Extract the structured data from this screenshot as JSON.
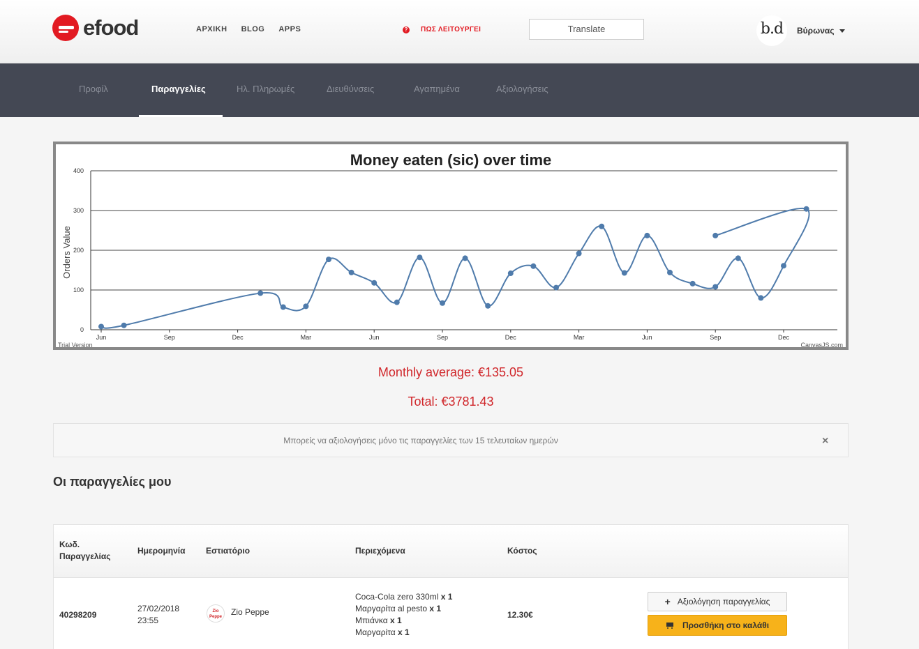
{
  "header": {
    "logo_text": "efood",
    "nav": [
      "ΑΡΧΙΚΗ",
      "BLOG",
      "APPS"
    ],
    "help_icon": "?",
    "help_text": "ΠΩΣ ΛΕΙΤΟΥΡΓΕΙ",
    "translate_label": "Translate",
    "avatar_text": "b.d",
    "user_name": "Βύρωνας"
  },
  "subnav": {
    "tabs": [
      "Προφίλ",
      "Παραγγελίες",
      "Ηλ. Πληρωμές",
      "Διευθύνσεις",
      "Αγαπημένα",
      "Αξιολογήσεις"
    ],
    "active_index": 1
  },
  "chart_data": {
    "type": "line",
    "title": "Money eaten (sic) over time",
    "ylabel": "Orders Value",
    "xlabel": "",
    "ylim": [
      0,
      400
    ],
    "yticks": [
      0,
      100,
      200,
      300,
      400
    ],
    "xticks": [
      "Jun",
      "Sep",
      "Dec",
      "Mar",
      "Jun",
      "Sep",
      "Dec",
      "Mar",
      "Jun",
      "Sep",
      "Dec"
    ],
    "x_months": [
      0,
      1,
      7,
      8,
      9,
      10,
      11,
      12,
      13,
      14,
      15,
      16,
      17,
      18,
      19,
      20,
      21,
      22,
      23,
      24,
      25,
      26,
      27,
      28,
      29,
      30,
      31
    ],
    "values": [
      8,
      11,
      92,
      57,
      59,
      177,
      144,
      118,
      69,
      182,
      67,
      180,
      60,
      142,
      160,
      106,
      192,
      260,
      143,
      237,
      144,
      116,
      108,
      180,
      80,
      161,
      304,
      237
    ],
    "grid": true,
    "line_color": "#4f7bab",
    "watermark_left": "Trial Version",
    "watermark_right": "CanvasJS.com"
  },
  "summary": {
    "monthly_average": "Monthly average: €135.05",
    "total": "Total: €3781.43"
  },
  "notice": {
    "text": "Μπορείς να αξιολογήσεις μόνο τις παραγγελίες των 15 τελευταίων ημερών",
    "close_label": "×"
  },
  "orders": {
    "title": "Οι παραγγελίες μου",
    "headers": {
      "code_line1": "Κωδ.",
      "code_line2": "Παραγγελίας",
      "date": "Ημερομηνία",
      "restaurant": "Εστιατόριο",
      "contents": "Περιεχόμενα",
      "cost": "Κόστος"
    },
    "rows": [
      {
        "code": "40298209",
        "date": "27/02/2018",
        "time": "23:55",
        "restaurant_logo": "Zio Peppe",
        "restaurant": "Zio Peppe",
        "items": [
          {
            "name": "Coca-Cola zero 330ml",
            "qty": "x 1"
          },
          {
            "name": "Μαργαρίτα al pesto",
            "qty": "x 1"
          },
          {
            "name": "Μπιάνκα",
            "qty": "x 1"
          },
          {
            "name": "Μαργαρίτα",
            "qty": "x 1"
          }
        ],
        "cost": "12.30€",
        "rate_label": "Αξιολόγηση παραγγελίας",
        "cart_label": "Προσθήκη στο καλάθι"
      }
    ]
  }
}
